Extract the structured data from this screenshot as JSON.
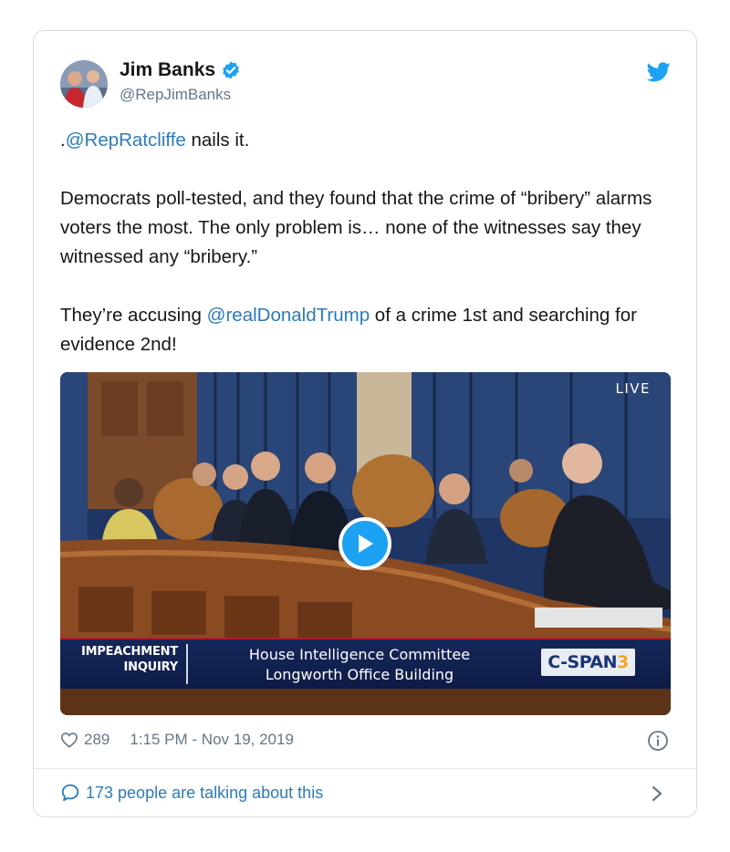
{
  "tweet": {
    "author": {
      "display_name": "Jim Banks",
      "handle": "@RepJimBanks",
      "verified": true,
      "avatar_icon": "profile-photo"
    },
    "brand_icon": "twitter-bird-icon",
    "text": {
      "p1_prefix": ".",
      "p1_mention": "@RepRatcliffe",
      "p1_rest": " nails it.",
      "p2": "Democrats poll-tested, and they found that the crime of “bribery” alarms voters the most. The only problem is… none of the witnesses say they witnessed any “bribery.”",
      "p3_prefix": "They’re accusing ",
      "p3_mention": "@realDonaldTrump",
      "p3_rest": " of a crime 1st and searching for evidence 2nd!"
    },
    "video": {
      "live_label": "LIVE",
      "banner": {
        "left_line1": "IMPEACHMENT",
        "left_line2": "INQUIRY",
        "center_line1": "House Intelligence Committee",
        "center_line2": "Longworth Office Building",
        "network": "C-SPAN",
        "network_number": "3"
      }
    },
    "likes": "289",
    "timestamp": "1:15 PM - Nov 19, 2019",
    "talking": "173 people are talking about this"
  },
  "colors": {
    "link": "#2b7bb9",
    "twitter_blue": "#1da1f2",
    "muted": "#657786"
  }
}
